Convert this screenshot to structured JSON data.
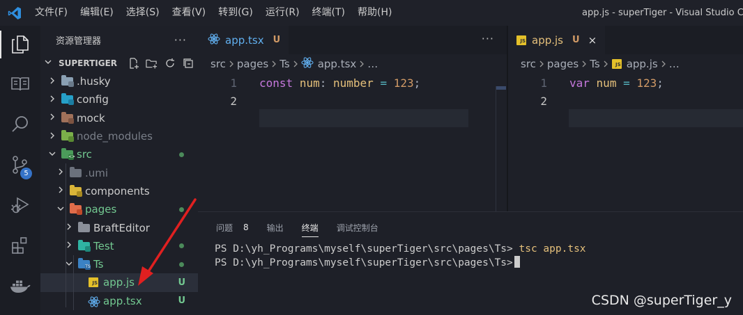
{
  "app": {
    "window_title": "app.js - superTiger - Visual Studio Co"
  },
  "menu": [
    "文件(F)",
    "编辑(E)",
    "选择(S)",
    "查看(V)",
    "转到(G)",
    "运行(R)",
    "终端(T)",
    "帮助(H)"
  ],
  "activity_bar": {
    "items": [
      {
        "name": "explorer-icon"
      },
      {
        "name": "book-icon"
      },
      {
        "name": "search-icon"
      },
      {
        "name": "source-control-icon",
        "badge": "5"
      },
      {
        "name": "run-debug-icon"
      },
      {
        "name": "extensions-icon"
      },
      {
        "name": "docker-icon"
      }
    ]
  },
  "sidebar": {
    "title": "资源管理器",
    "more": "···",
    "root": "SUPERTIGER",
    "items": [
      {
        "label": ".husky",
        "color": "#cccccc",
        "status": ""
      },
      {
        "label": "config",
        "color": "#cccccc",
        "status": ""
      },
      {
        "label": "mock",
        "color": "#cccccc",
        "status": ""
      },
      {
        "label": "node_modules",
        "color": "#7a7f89",
        "status": ""
      },
      {
        "label": "src",
        "color": "#73c991",
        "status": "dot"
      },
      {
        "label": ".umi",
        "color": "#7a7f89",
        "status": ""
      },
      {
        "label": "components",
        "color": "#cccccc",
        "status": ""
      },
      {
        "label": "pages",
        "color": "#73c991",
        "status": "dot"
      },
      {
        "label": "BraftEditor",
        "color": "#cccccc",
        "status": ""
      },
      {
        "label": "Test",
        "color": "#73c991",
        "status": "dot"
      },
      {
        "label": "Ts",
        "color": "#73c991",
        "status": "dot"
      },
      {
        "label": "app.js",
        "color": "#73c991",
        "status": "U"
      },
      {
        "label": "app.tsx",
        "color": "#73c991",
        "status": "U"
      }
    ]
  },
  "editor_left": {
    "tab": {
      "label": "app.tsx",
      "status": "U"
    },
    "more": "···",
    "breadcrumb": [
      "src",
      "pages",
      "Ts",
      "app.tsx",
      "…"
    ],
    "lines": [
      {
        "number": "1",
        "tokens": [
          [
            "const",
            "kw"
          ],
          [
            " ",
            "punc"
          ],
          [
            "num",
            "var"
          ],
          [
            ":",
            "punc"
          ],
          [
            " ",
            "punc"
          ],
          [
            "number",
            "typ"
          ],
          [
            " ",
            "punc"
          ],
          [
            "=",
            "op"
          ],
          [
            " ",
            "punc"
          ],
          [
            "123",
            "num"
          ],
          [
            ";",
            "punc"
          ]
        ]
      },
      {
        "number": "2",
        "tokens": []
      }
    ]
  },
  "editor_right": {
    "tab": {
      "label": "app.js",
      "status": "U",
      "close": "×"
    },
    "breadcrumb": [
      "src",
      "pages",
      "Ts",
      "app.js",
      "…"
    ],
    "lines": [
      {
        "number": "1",
        "tokens": [
          [
            "var",
            "kw"
          ],
          [
            " ",
            "punc"
          ],
          [
            "num",
            "var"
          ],
          [
            " ",
            "punc"
          ],
          [
            "=",
            "op"
          ],
          [
            " ",
            "punc"
          ],
          [
            "123",
            "num"
          ],
          [
            ";",
            "punc"
          ]
        ]
      },
      {
        "number": "2",
        "tokens": []
      }
    ]
  },
  "panel": {
    "tabs": [
      {
        "label": "问题",
        "count": "8"
      },
      {
        "label": "输出"
      },
      {
        "label": "终端",
        "active": true
      },
      {
        "label": "调试控制台"
      }
    ],
    "terminal": {
      "prompt": "PS D:\\yh_Programs\\myself\\superTiger\\src\\pages\\Ts>",
      "command": "tsc app.tsx"
    }
  },
  "watermark": "CSDN @superTiger_y",
  "colors": {
    "accent": "#3573c8",
    "untracked": "#73c991",
    "annotation_arrow": "#e02020"
  }
}
